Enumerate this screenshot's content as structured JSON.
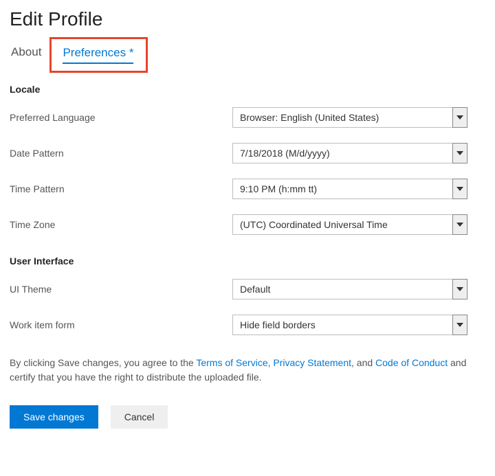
{
  "header": {
    "title": "Edit Profile"
  },
  "tabs": {
    "about": "About",
    "preferences": "Preferences *"
  },
  "sections": {
    "locale": {
      "title": "Locale",
      "fields": {
        "language": {
          "label": "Preferred Language",
          "value": "Browser: English (United States)"
        },
        "datePattern": {
          "label": "Date Pattern",
          "value": "7/18/2018 (M/d/yyyy)"
        },
        "timePattern": {
          "label": "Time Pattern",
          "value": "9:10 PM (h:mm tt)"
        },
        "timeZone": {
          "label": "Time Zone",
          "value": "(UTC) Coordinated Universal Time"
        }
      }
    },
    "ui": {
      "title": "User Interface",
      "fields": {
        "theme": {
          "label": "UI Theme",
          "value": "Default"
        },
        "workItemForm": {
          "label": "Work item form",
          "value": "Hide field borders"
        }
      }
    }
  },
  "agreement": {
    "prefix": "By clicking Save changes, you agree to the ",
    "tos": "Terms of Service",
    "sep1": ", ",
    "privacy": "Privacy Statement",
    "sep2": ", and ",
    "coc": "Code of Conduct",
    "suffix": " and certify that you have the right to distribute the uploaded file."
  },
  "buttons": {
    "save": "Save changes",
    "cancel": "Cancel"
  }
}
